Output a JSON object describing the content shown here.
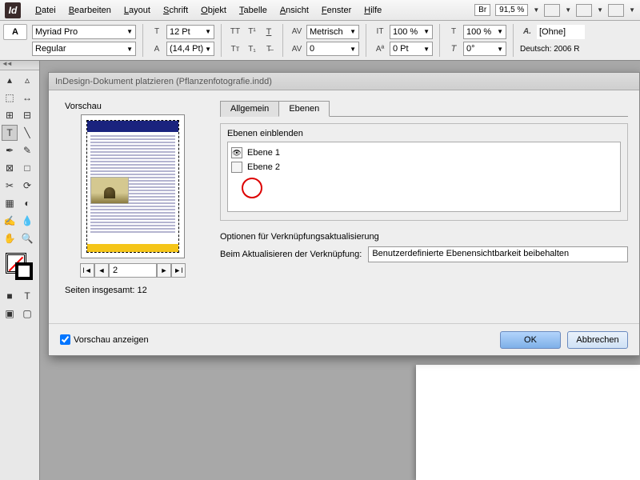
{
  "menubar": {
    "items": [
      "Datei",
      "Bearbeiten",
      "Layout",
      "Schrift",
      "Objekt",
      "Tabelle",
      "Ansicht",
      "Fenster",
      "Hilfe"
    ],
    "br": "Br",
    "zoom": "91,5 %"
  },
  "controlbar": {
    "font": "Myriad Pro",
    "style": "Regular",
    "size": "12 Pt",
    "leading": "(14,4 Pt)",
    "metrics": "Metrisch",
    "tracking": "0",
    "hscale": "100 %",
    "vscale": "100 %",
    "baseline": "0 Pt",
    "charstyle": "[Ohne]",
    "lang": "Deutsch: 2006 R"
  },
  "dialog": {
    "title": "InDesign-Dokument platzieren (Pflanzenfotografie.indd)",
    "preview_label": "Vorschau",
    "page_current": "2",
    "pages_total_label": "Seiten insgesamt: 12",
    "show_preview": "Vorschau anzeigen",
    "tabs": {
      "general": "Allgemein",
      "layers": "Ebenen"
    },
    "layers_show": "Ebenen einblenden",
    "layers": [
      {
        "name": "Ebene 1",
        "visible": true
      },
      {
        "name": "Ebene 2",
        "visible": false
      }
    ],
    "update_section": "Optionen für Verknüpfungsaktualisierung",
    "update_label": "Beim Aktualisieren der Verknüpfung:",
    "update_value": "Benutzerdefinierte Ebenensichtbarkeit beibehalten",
    "ok": "OK",
    "cancel": "Abbrechen"
  }
}
